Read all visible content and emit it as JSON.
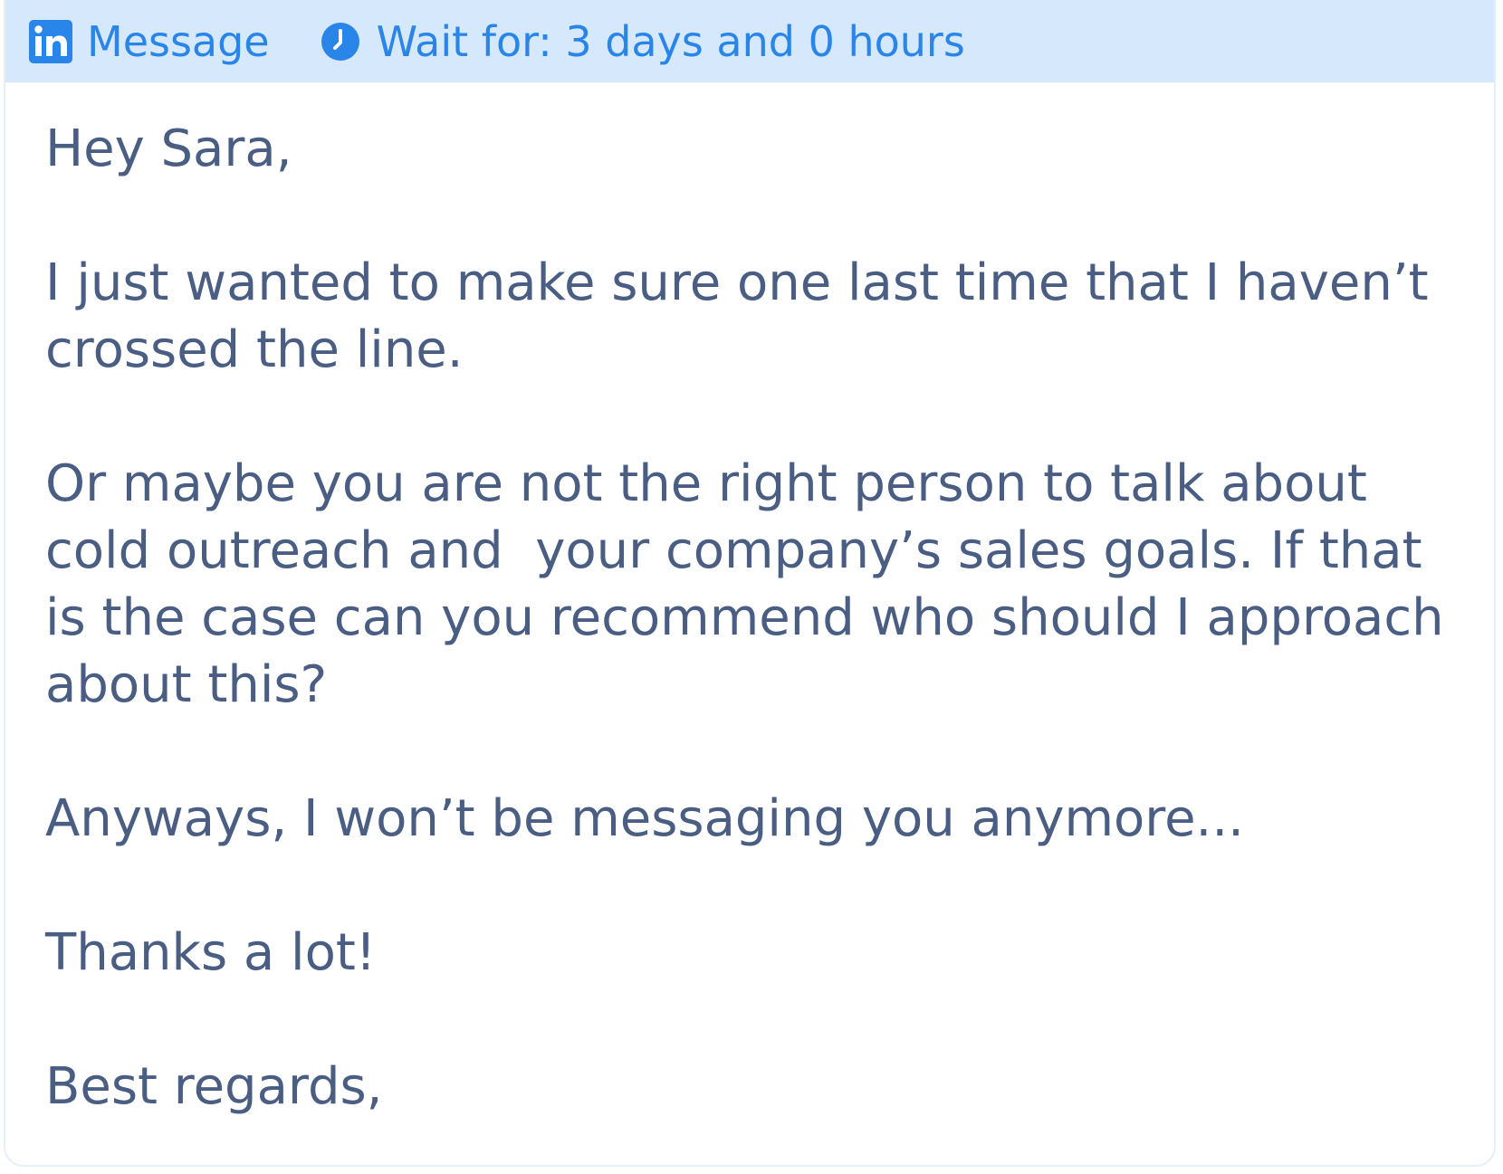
{
  "header": {
    "step_icon": "linkedin-icon",
    "step_label": "Message",
    "wait_icon": "clock-icon",
    "wait_label": "Wait for: 3 days and 0 hours"
  },
  "colors": {
    "accent": "#2a85e8",
    "header_bg": "#d6e8fb",
    "text": "#4a5d82"
  },
  "message": {
    "greeting": "Hey Sara,",
    "paragraph_1": "I just wanted to make sure one last time that I haven’t crossed the line.",
    "paragraph_2": "Or maybe you are not the right person to talk about cold outreach and  your company’s sales goals. If that is the case can you recommend who should I approach about this?",
    "paragraph_3": "Anyways, I won’t be messaging you anymore...",
    "paragraph_4": "Thanks a lot!",
    "signoff": "Best regards,"
  }
}
